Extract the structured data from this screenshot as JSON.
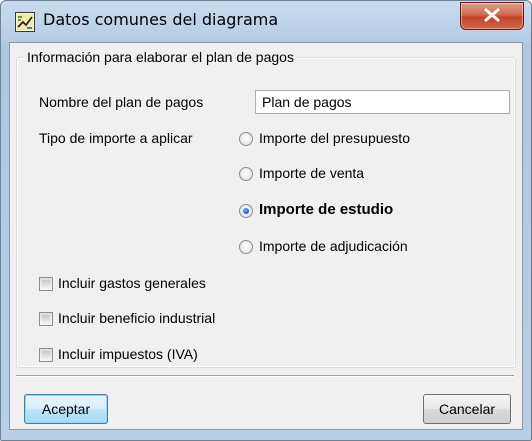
{
  "window": {
    "title": "Datos comunes del diagrama"
  },
  "group": {
    "legend": "Información para elaborar el plan de pagos",
    "plan_name_label": "Nombre del plan de pagos",
    "plan_name_value": "Plan de pagos",
    "amount_type_label": "Tipo de importe a aplicar",
    "radio_options": [
      {
        "label": "Importe del presupuesto",
        "selected": false
      },
      {
        "label": "Importe de venta",
        "selected": false
      },
      {
        "label": "Importe de estudio",
        "selected": true
      },
      {
        "label": "Importe de adjudicación",
        "selected": false
      }
    ],
    "checkboxes": [
      {
        "label": "Incluir gastos generales",
        "checked": false
      },
      {
        "label": "Incluir beneficio industrial",
        "checked": false
      },
      {
        "label": "Incluir impuestos (IVA)",
        "checked": false
      }
    ]
  },
  "buttons": {
    "accept_label": "Aceptar",
    "cancel_label": "Cancelar"
  },
  "colors": {
    "titlebar": "#b9cfe7",
    "close_button": "#c0432a",
    "radio_selected": "#1f62c2"
  },
  "icons": {
    "app": "diagram-app-icon",
    "close": "close-icon"
  }
}
